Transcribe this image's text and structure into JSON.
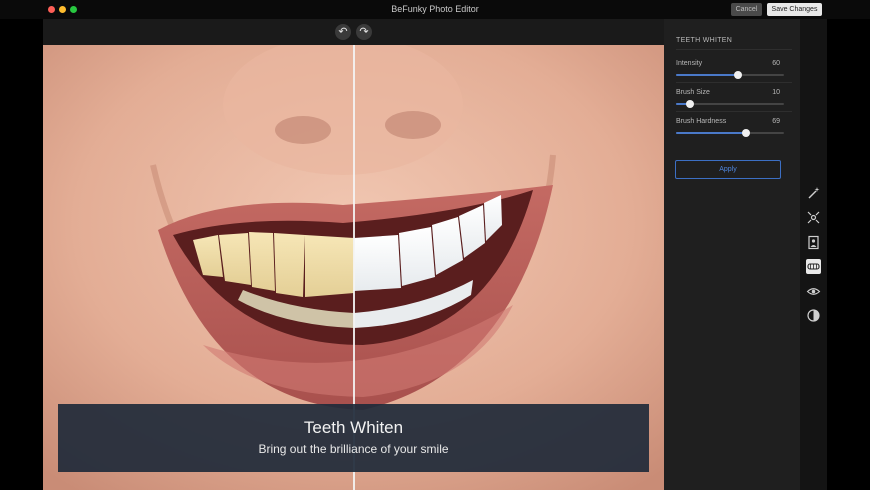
{
  "window": {
    "title": "BeFunky Photo Editor",
    "cancel_label": "Cancel",
    "save_label": "Save Changes"
  },
  "toolbar": {
    "undo_icon": "undo-icon",
    "redo_icon": "redo-icon"
  },
  "caption": {
    "title": "Teeth Whiten",
    "subtitle": "Bring out the brilliance of your smile"
  },
  "panel": {
    "title": "TEETH WHITEN",
    "sliders": [
      {
        "label": "Intensity",
        "value": "60",
        "fraction": 0.57
      },
      {
        "label": "Brush Size",
        "value": "10",
        "fraction": 0.13
      },
      {
        "label": "Brush Hardness",
        "value": "69",
        "fraction": 0.65
      }
    ],
    "apply_label": "Apply"
  },
  "tools": [
    {
      "icon": "magic-wand-icon",
      "active": false
    },
    {
      "icon": "sparkle-icon",
      "active": false
    },
    {
      "icon": "portrait-frame-icon",
      "active": false
    },
    {
      "icon": "teeth-icon",
      "active": true
    },
    {
      "icon": "eye-icon",
      "active": false
    },
    {
      "icon": "contrast-icon",
      "active": false
    }
  ],
  "colors": {
    "accent": "#3c6fc4",
    "slider_fill": "#4a79c9"
  }
}
